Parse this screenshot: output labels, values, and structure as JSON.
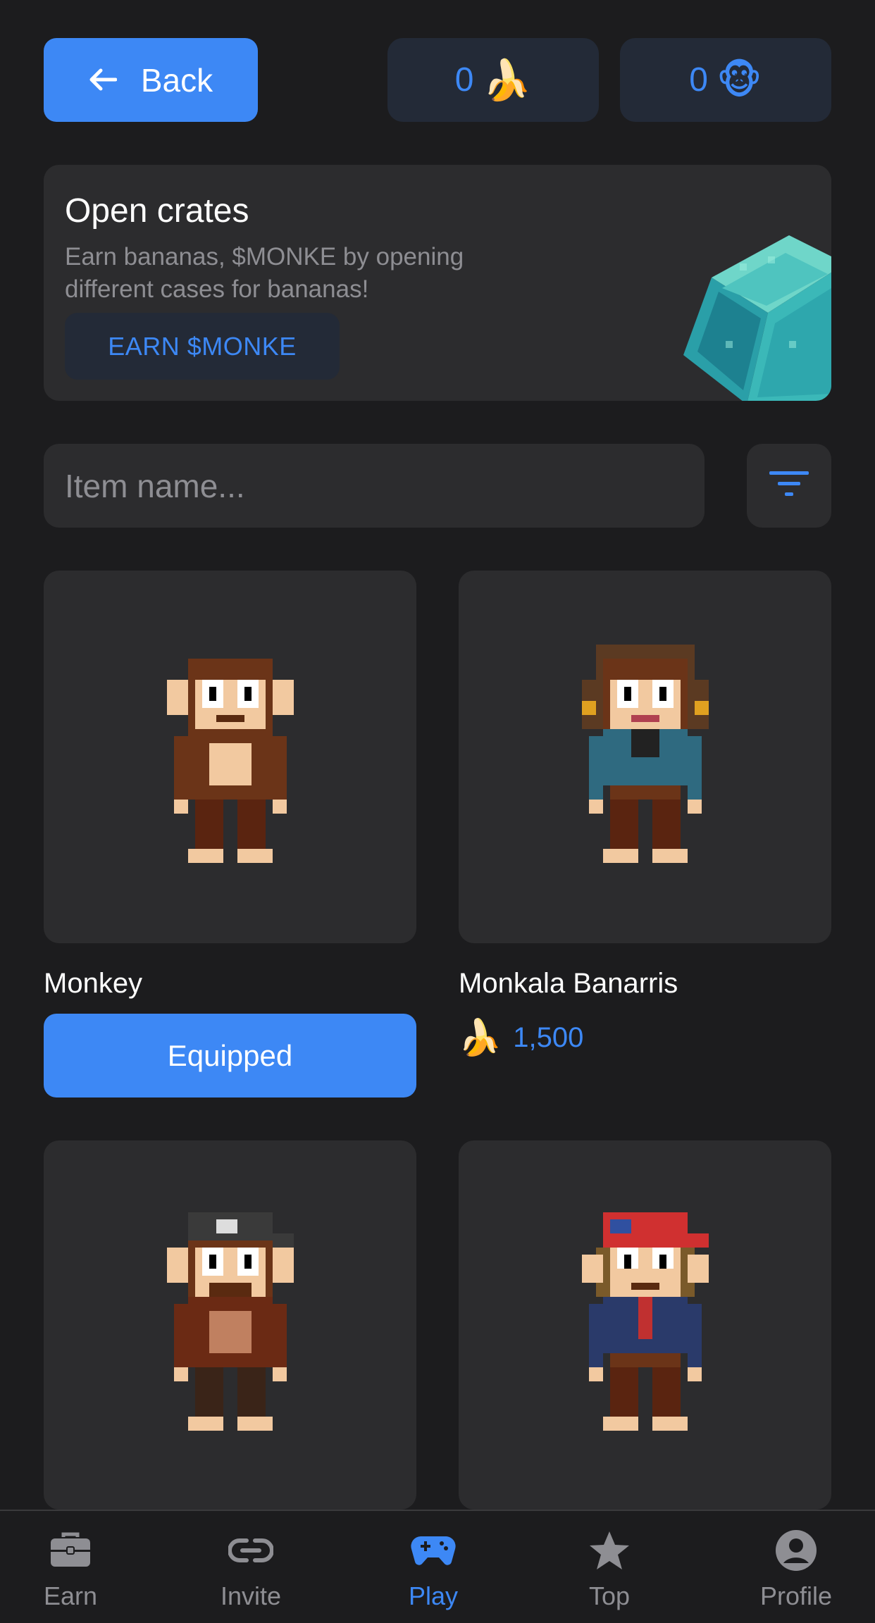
{
  "header": {
    "back_label": "Back",
    "banana_count": "0",
    "banana_emoji": "🍌",
    "monke_count": "0",
    "monke_emoji": "🐵"
  },
  "crates": {
    "title": "Open crates",
    "description": "Earn bananas, $MONKE by opening different cases for bananas!",
    "button_label": "EARN $MONKE"
  },
  "search": {
    "placeholder": "Item name..."
  },
  "items": [
    {
      "name": "Monkey",
      "status": "Equipped"
    },
    {
      "name": "Monkala Banarris",
      "price": "1,500",
      "price_emoji": "🍌"
    },
    {
      "name": ""
    },
    {
      "name": ""
    }
  ],
  "nav": [
    {
      "label": "Earn",
      "icon": "briefcase-icon"
    },
    {
      "label": "Invite",
      "icon": "link-icon"
    },
    {
      "label": "Play",
      "icon": "gamepad-icon",
      "active": true
    },
    {
      "label": "Top",
      "icon": "star-icon"
    },
    {
      "label": "Profile",
      "icon": "profile-icon"
    }
  ],
  "colors": {
    "accent": "#3d88f5",
    "background": "#1c1c1e",
    "card": "#2c2c2e",
    "muted": "#8e8e93"
  }
}
